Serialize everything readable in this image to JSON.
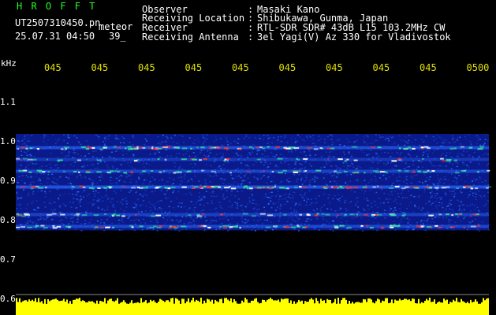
{
  "header": {
    "brand": "H R O F F T",
    "filename": "UT2507310450.pn",
    "meteor_label": "meteor",
    "timestamp": "25.07.31 04:50",
    "count": "39_",
    "fields": [
      {
        "label": "Observer",
        "value": "Masaki Kano"
      },
      {
        "label": "Receiving Location",
        "value": "Shibukawa, Gunma, Japan"
      },
      {
        "label": "Receiver",
        "value": "RTL-SDR SDR# 43dB L15 103.2MHz CW"
      },
      {
        "label": "Receiving Antenna",
        "value": "3el Yagi(V) Az 330 for Vladivostok"
      }
    ],
    "separator": ":"
  },
  "chart_data": {
    "type": "heatmap",
    "title": "",
    "ylabel": "kHz",
    "yticks": [
      "1.1",
      "1.0",
      "0.9",
      "0.8",
      "0.7",
      "0.6"
    ],
    "ylim": [
      0.6,
      1.15
    ],
    "xticks": [
      "045",
      "045",
      "045",
      "045",
      "045",
      "045",
      "045",
      "045",
      "045",
      "0500"
    ],
    "signal_bands_khz": [
      {
        "freq": 0.985,
        "strength": 0.8
      },
      {
        "freq": 0.925,
        "strength": 0.6
      },
      {
        "freq": 0.885,
        "strength": 1.0
      },
      {
        "freq": 0.815,
        "strength": 0.55
      },
      {
        "freq": 0.785,
        "strength": 0.7
      },
      {
        "freq": 0.955,
        "strength": 0.35
      }
    ],
    "noise_floor_khz": [
      0.775,
      1.02
    ],
    "colors": {
      "background": "#000000",
      "noise_low": "#0a1a8a",
      "noise_mid": "#2a6aff",
      "signal_mid": "#30e0a0",
      "signal_high": "#ff3030",
      "amplitude_bar": "#ffff00",
      "tick_color": "#e0e000"
    }
  }
}
